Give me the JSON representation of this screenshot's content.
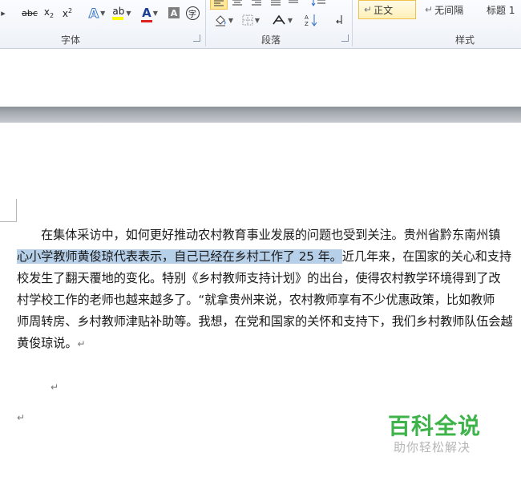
{
  "ribbon": {
    "font_group": {
      "label": "字体",
      "btn_strike": "abc",
      "btn_sub": "x",
      "btn_sub_suffix": "2",
      "btn_sup": "x",
      "btn_sup_suffix": "2",
      "btn_text_effect": "A",
      "btn_highlight": "ab",
      "btn_font_color": "A",
      "btn_char_shading": "A",
      "btn_enclose": "字"
    },
    "paragraph_group": {
      "label": "段落"
    },
    "styles_group": {
      "label": "样式",
      "items": [
        {
          "label": "正文",
          "marker": "↵"
        },
        {
          "label": "无间隔",
          "marker": "↵"
        },
        {
          "label": "标题 1",
          "marker": ""
        }
      ]
    },
    "highlight_color": "#ffff00",
    "font_color": "#e02020"
  },
  "document": {
    "lines": [
      {
        "pre": "在集体采访中，如何更好推动农村教育事业发展的问题也受到关注。贵州省黔东南州镇",
        "sel": "",
        "post": ""
      },
      {
        "pre": "",
        "sel": "心小学教师黄俊琼代表表示，自己已经在乡村工作了 25 年。",
        "post": "近几年来，在国家的关心和支持"
      },
      {
        "pre": "校发生了翻天覆地的变化。特别《乡村教师支持计划》的出台，使得农村教学环境得到了改",
        "sel": "",
        "post": ""
      },
      {
        "pre": "村学校工作的老师也越来越多了。“就拿贵州来说，农村教师享有不少优惠政策，比如教师",
        "sel": "",
        "post": ""
      },
      {
        "pre": "师周转房、乡村教师津贴补助等。我想，在党和国家的关怀和支持下，我们乡村教师队伍会越",
        "sel": "",
        "post": ""
      },
      {
        "pre": "黄俊琼说。",
        "sel": "",
        "post": ""
      }
    ],
    "paragraph_mark": "↵",
    "selection_color": "#b7d0ea"
  },
  "watermark": {
    "title": "百科全说",
    "subtitle": "助你轻松解决",
    "color": "#3db34a"
  }
}
